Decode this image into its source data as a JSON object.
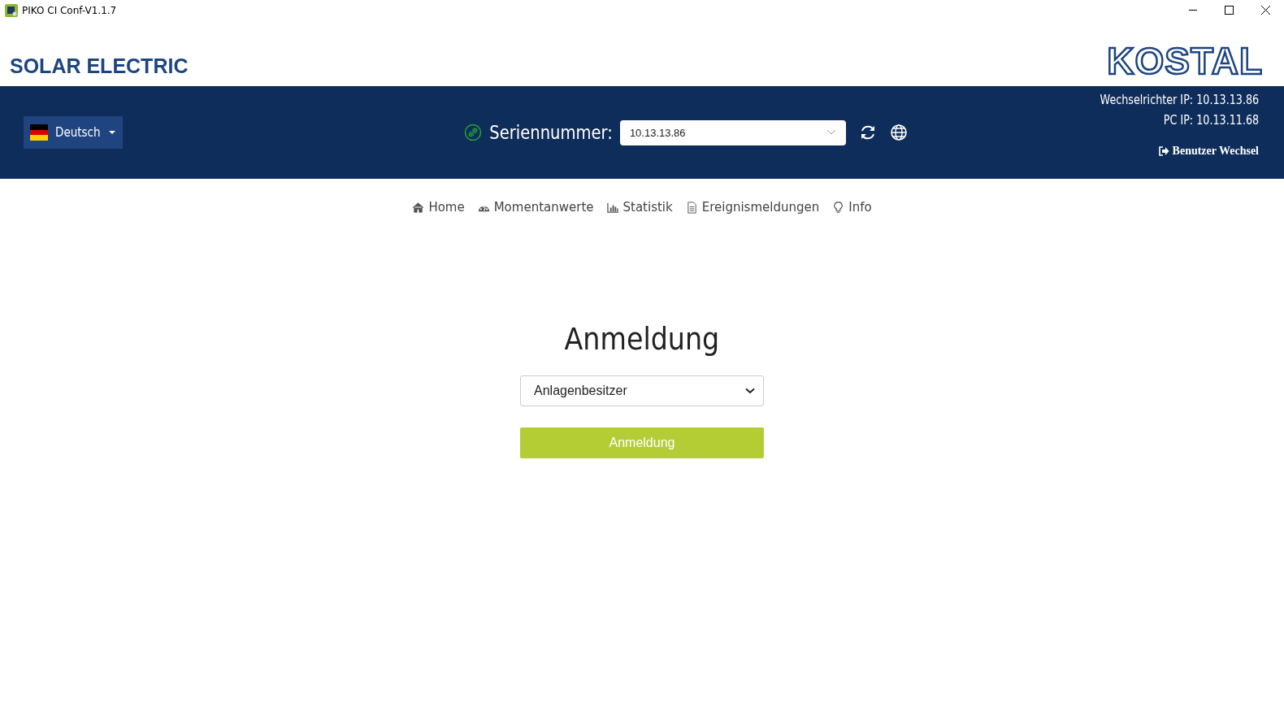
{
  "window": {
    "title": "PIKO CI Conf-V1.1.7"
  },
  "brand": "SOLAR ELECTRIC",
  "logo": "KOSTAL",
  "header": {
    "language": "Deutsch",
    "serial_label": "Seriennummer:",
    "serial_value": "10.13.13.86",
    "connected": true,
    "info_lines": [
      "Wechselrichter IP: 10.13.13.86",
      "PC IP: 10.13.11.68"
    ],
    "user_switch": "Benutzer Wechsel"
  },
  "nav": [
    {
      "kind": "home",
      "label": "Home"
    },
    {
      "kind": "gauge",
      "label": "Momentanwerte"
    },
    {
      "kind": "chart",
      "label": "Statistik"
    },
    {
      "kind": "document",
      "label": "Ereignismeldungen"
    },
    {
      "kind": "bulb",
      "label": "Info"
    }
  ],
  "login": {
    "title": "Anmeldung",
    "role": "Anlagenbesitzer",
    "button": "Anmeldung"
  }
}
